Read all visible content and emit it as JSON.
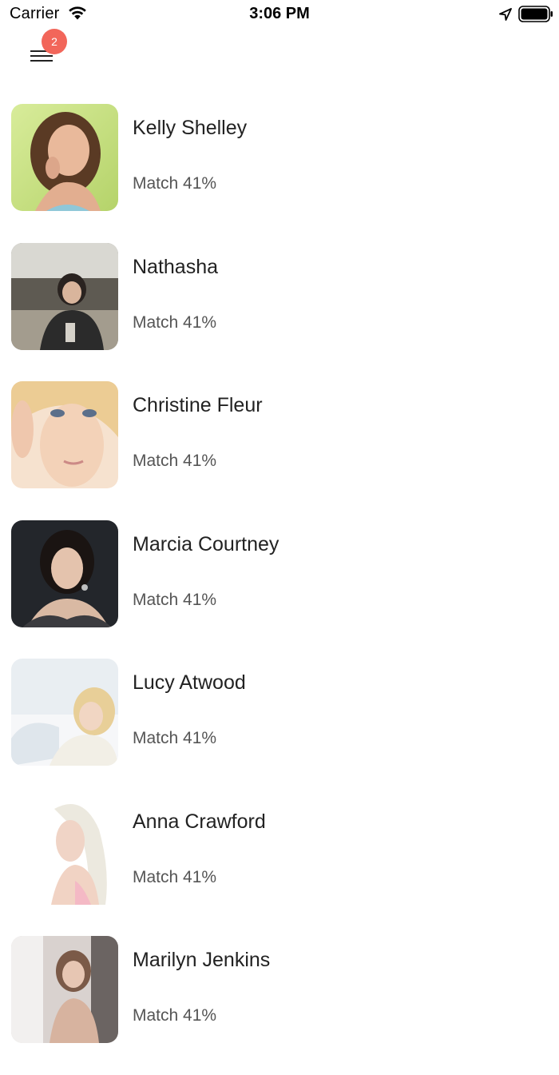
{
  "status_bar": {
    "carrier": "Carrier",
    "time": "3:06 PM",
    "icons": [
      "wifi-icon",
      "location-arrow-icon",
      "battery-icon"
    ]
  },
  "nav": {
    "menu_icon": "hamburger-menu-icon",
    "badge_count": "2",
    "badge_color": "#f2665a"
  },
  "matches": [
    {
      "name": "Kelly Shelley",
      "match": "Match 41%"
    },
    {
      "name": "Nathasha",
      "match": "Match 41%"
    },
    {
      "name": "Christine Fleur",
      "match": "Match 41%"
    },
    {
      "name": "Marcia Courtney",
      "match": "Match 41%"
    },
    {
      "name": "Lucy Atwood",
      "match": "Match 41%"
    },
    {
      "name": "Anna Crawford",
      "match": "Match 41%"
    },
    {
      "name": "Marilyn Jenkins",
      "match": "Match 41%"
    }
  ]
}
